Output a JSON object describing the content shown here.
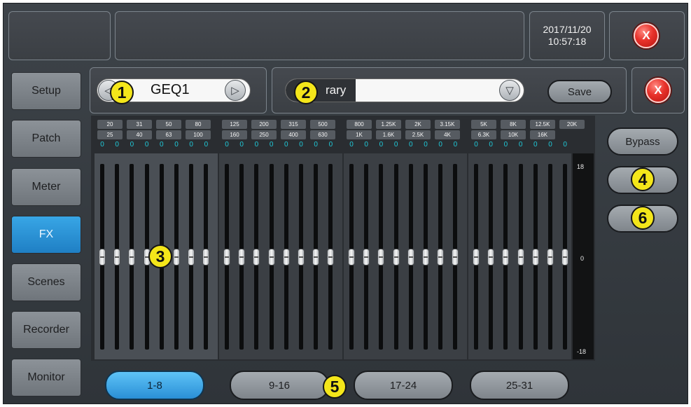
{
  "header": {
    "date": "2017/11/20",
    "time": "10:57:18",
    "close_label": "X"
  },
  "nav": {
    "items": [
      {
        "label": "Setup",
        "active": false
      },
      {
        "label": "Patch",
        "active": false
      },
      {
        "label": "Meter",
        "active": false
      },
      {
        "label": "FX",
        "active": true
      },
      {
        "label": "Scenes",
        "active": false
      },
      {
        "label": "Recorder",
        "active": false
      },
      {
        "label": "Monitor",
        "active": false
      }
    ]
  },
  "fx_selector": {
    "name": "GEQ1",
    "prev_icon": "chevron-left-icon",
    "next_icon": "play-right-icon"
  },
  "library": {
    "label": "rary",
    "value": "",
    "dropdown_icon": "triangle-down-icon",
    "save_label": "Save",
    "close_label": "X"
  },
  "eq": {
    "freq_row1": [
      "20",
      "31",
      "50",
      "80",
      "125",
      "200",
      "315",
      "500",
      "800",
      "1.25K",
      "2K",
      "3.15K",
      "5K",
      "8K",
      "12.5K",
      "20K"
    ],
    "freq_row2": [
      "25",
      "40",
      "63",
      "100",
      "160",
      "250",
      "400",
      "630",
      "1K",
      "1.6K",
      "2.5K",
      "4K",
      "6.3K",
      "10K",
      "16K"
    ],
    "gains": [
      "0",
      "0",
      "0",
      "0",
      "0",
      "0",
      "0",
      "0",
      "0",
      "0",
      "0",
      "0",
      "0",
      "0",
      "0",
      "0",
      "0",
      "0",
      "0",
      "0",
      "0",
      "0",
      "0",
      "0",
      "0",
      "0",
      "0",
      "0",
      "0",
      "0",
      "0"
    ],
    "fader_levels_db": [
      0,
      0,
      0,
      0,
      0,
      0,
      0,
      0,
      0,
      0,
      0,
      0,
      0,
      0,
      0,
      0,
      0,
      0,
      0,
      0,
      0,
      0,
      0,
      0,
      0,
      0,
      0,
      0,
      0,
      0,
      0
    ],
    "scale": {
      "max": "18",
      "mid": "0",
      "min": "-18"
    }
  },
  "side_buttons": {
    "bypass_label": "Bypass"
  },
  "pages": {
    "tabs": [
      {
        "label": "1-8",
        "active": true
      },
      {
        "label": "9-16",
        "active": false
      },
      {
        "label": "17-24",
        "active": false
      },
      {
        "label": "25-31",
        "active": false
      }
    ]
  },
  "callouts": [
    "1",
    "2",
    "3",
    "4",
    "5",
    "6"
  ],
  "colors": {
    "accent": "#2a8fd6",
    "gain_text": "#1fc9d8",
    "close_red": "#e8322b",
    "callout": "#f4e61a"
  }
}
